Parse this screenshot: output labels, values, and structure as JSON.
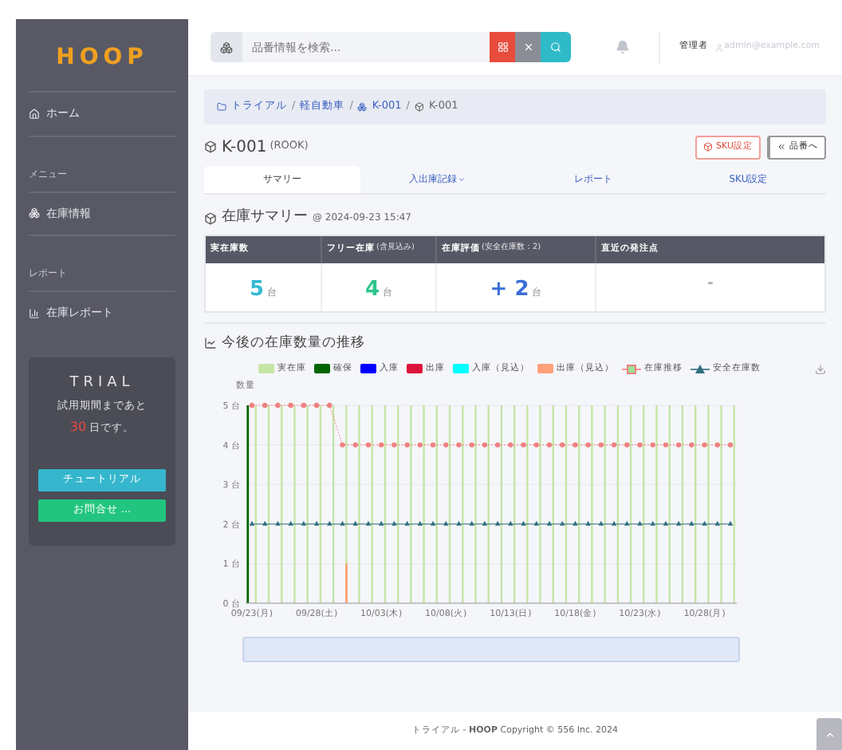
{
  "sidebar": {
    "logo": "HOOP",
    "items": [
      {
        "kind": "link",
        "label": "ホーム"
      },
      {
        "kind": "section",
        "label": "メニュー"
      },
      {
        "kind": "link",
        "label": "在庫情報"
      },
      {
        "kind": "section",
        "label": "レポート"
      },
      {
        "kind": "link",
        "label": "在庫レポート"
      }
    ],
    "trial": {
      "title": "TRIAL",
      "message": "試用期間まであと",
      "days": "30",
      "suffix": "日です。",
      "buttons": [
        {
          "label": "チュートリアル",
          "color": "#35b6cd"
        },
        {
          "label": "お問合せ ...",
          "color": "#22c57f"
        }
      ]
    }
  },
  "topbar": {
    "search": {
      "placeholder": "品番情報を検索..."
    },
    "role": "管理者",
    "user": "admin@example.com"
  },
  "breadcrumb": {
    "separator": "/",
    "items": [
      "トライアル",
      "軽自動車",
      "K-001",
      "K-001"
    ]
  },
  "item": {
    "code": "K-001",
    "name": "(ROOK)",
    "buttons": [
      {
        "label": "SKU設定",
        "kind": "danger"
      },
      {
        "label": "品番へ",
        "kind": "back"
      }
    ]
  },
  "tabs": [
    {
      "label": "サマリー",
      "selected": true,
      "dropdown": false
    },
    {
      "label": "入出庫記録",
      "selected": false,
      "dropdown": true
    },
    {
      "label": "レポート",
      "selected": false,
      "dropdown": false
    },
    {
      "label": "SKU設定",
      "selected": false,
      "dropdown": false
    }
  ],
  "summary": {
    "title": "在庫サマリー",
    "timestamp": "@ 2024-09-23 15:47",
    "columns": [
      {
        "label": "実在庫数"
      },
      {
        "label": "フリー在庫",
        "note": "(含見込み)"
      },
      {
        "label": "在庫評価",
        "note": "(安全在庫数：2)"
      },
      {
        "label": "直近の発注点"
      }
    ],
    "cells": [
      {
        "value": "5",
        "unit": "台",
        "color": "#36b9d4"
      },
      {
        "value": "4",
        "unit": "台",
        "color": "#2ec58a"
      },
      {
        "prefix": "+",
        "value": "2",
        "unit": "台",
        "color": "#3a6fd8"
      },
      {
        "value": "-",
        "color": "#aaaaaa"
      }
    ]
  },
  "chart_card": {
    "title": "今後の在庫数量の推移",
    "chart_data": {
      "type": "bar",
      "ylabel": "数量",
      "ylim": [
        0,
        5
      ],
      "grid": true,
      "yticks": [
        {
          "value": 0,
          "label": "0 台"
        },
        {
          "value": 1,
          "label": "1 台"
        },
        {
          "value": 2,
          "label": "2 台"
        },
        {
          "value": 3,
          "label": "3 台"
        },
        {
          "value": 4,
          "label": "4 台"
        },
        {
          "value": 5,
          "label": "5 台"
        }
      ],
      "categories": [
        "09/23(月)",
        null,
        null,
        null,
        null,
        "09/28(土)",
        null,
        null,
        null,
        null,
        "10/03(木)",
        null,
        null,
        null,
        null,
        "10/08(火)",
        null,
        null,
        null,
        null,
        "10/13(日)",
        null,
        null,
        null,
        null,
        "10/18(金)",
        null,
        null,
        null,
        null,
        "10/23(水)",
        null,
        null,
        null,
        null,
        "10/28(月)",
        null,
        null
      ],
      "series": [
        {
          "name": "実在庫",
          "type": "bar",
          "color": "#c5e5a5",
          "values": [
            5,
            5,
            5,
            5,
            5,
            5,
            5,
            5,
            5,
            5,
            5,
            5,
            5,
            5,
            5,
            5,
            5,
            5,
            5,
            5,
            5,
            5,
            5,
            5,
            5,
            5,
            5,
            5,
            5,
            5,
            5,
            5,
            5,
            5,
            5,
            5,
            5,
            5
          ]
        },
        {
          "name": "確保",
          "type": "bar",
          "color": "#006400",
          "values": [
            5,
            null,
            null,
            null,
            null,
            null,
            null,
            null,
            null,
            null,
            null,
            null,
            null,
            null,
            null,
            null,
            null,
            null,
            null,
            null,
            null,
            null,
            null,
            null,
            null,
            null,
            null,
            null,
            null,
            null,
            null,
            null,
            null,
            null,
            null,
            null,
            null,
            null
          ]
        },
        {
          "name": "入庫",
          "type": "bar",
          "color": "#0000ff",
          "values": [
            null,
            null,
            null,
            null,
            null,
            null,
            null,
            null,
            null,
            null,
            null,
            null,
            null,
            null,
            null,
            null,
            null,
            null,
            null,
            null,
            null,
            null,
            null,
            null,
            null,
            null,
            null,
            null,
            null,
            null,
            null,
            null,
            null,
            null,
            null,
            null,
            null,
            null
          ]
        },
        {
          "name": "出庫",
          "type": "bar",
          "color": "#dc143c",
          "values": [
            null,
            null,
            null,
            null,
            null,
            null,
            null,
            null,
            null,
            null,
            null,
            null,
            null,
            null,
            null,
            null,
            null,
            null,
            null,
            null,
            null,
            null,
            null,
            null,
            null,
            null,
            null,
            null,
            null,
            null,
            null,
            null,
            null,
            null,
            null,
            null,
            null,
            null
          ]
        },
        {
          "name": "入庫（見込）",
          "type": "bar",
          "color": "#00ffff",
          "values": [
            null,
            null,
            null,
            null,
            null,
            null,
            null,
            null,
            null,
            null,
            null,
            null,
            null,
            null,
            null,
            null,
            null,
            null,
            null,
            null,
            null,
            null,
            null,
            null,
            null,
            null,
            null,
            null,
            null,
            null,
            null,
            null,
            null,
            null,
            null,
            null,
            null,
            null
          ]
        },
        {
          "name": "出庫（見込）",
          "type": "bar",
          "color": "#ffa07a",
          "values": [
            null,
            null,
            null,
            null,
            null,
            null,
            null,
            1,
            null,
            null,
            null,
            null,
            null,
            null,
            null,
            null,
            null,
            null,
            null,
            null,
            null,
            null,
            null,
            null,
            null,
            null,
            null,
            null,
            null,
            null,
            null,
            null,
            null,
            null,
            null,
            null,
            null,
            null
          ]
        },
        {
          "name": "在庫推移",
          "type": "line",
          "color": "#f08080",
          "line_style": "dashed",
          "marker": "circle",
          "values": [
            5,
            5,
            5,
            5,
            5,
            5,
            5,
            4,
            4,
            4,
            4,
            4,
            4,
            4,
            4,
            4,
            4,
            4,
            4,
            4,
            4,
            4,
            4,
            4,
            4,
            4,
            4,
            4,
            4,
            4,
            4,
            4,
            4,
            4,
            4,
            4,
            4,
            4
          ]
        },
        {
          "name": "安全在庫数",
          "type": "line",
          "color": "#2f6f7f",
          "line_style": "solid",
          "marker": "triangle",
          "values": [
            2,
            2,
            2,
            2,
            2,
            2,
            2,
            2,
            2,
            2,
            2,
            2,
            2,
            2,
            2,
            2,
            2,
            2,
            2,
            2,
            2,
            2,
            2,
            2,
            2,
            2,
            2,
            2,
            2,
            2,
            2,
            2,
            2,
            2,
            2,
            2,
            2,
            2
          ]
        }
      ]
    }
  },
  "footer": {
    "text": "トライアル - **HOOP** Copyright © 556 Inc. 2024"
  }
}
